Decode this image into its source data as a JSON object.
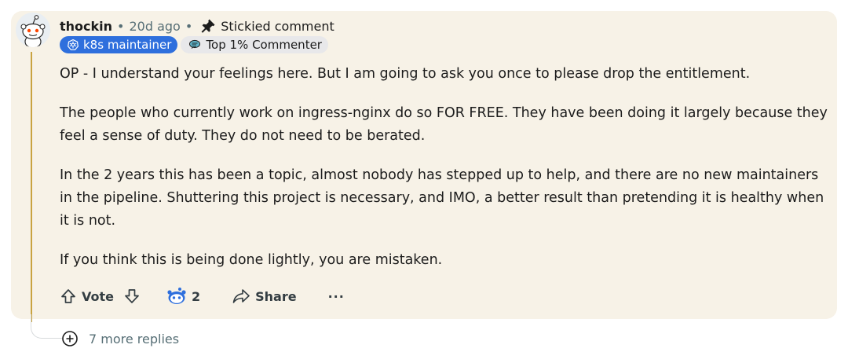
{
  "comment": {
    "username": "thockin",
    "age": "20d ago",
    "sticky_label": "Stickied comment",
    "flairs": [
      {
        "label": "k8s maintainer",
        "icon": "kubernetes-icon"
      },
      {
        "label": "Top 1% Commenter",
        "icon": "top-commenter-icon"
      }
    ],
    "paragraphs": [
      "OP - I understand your feelings here. But I am going to ask you once to please drop the entitlement.",
      "The people who currently work on ingress-nginx do so FOR FREE. They have been doing it largely because they feel a sense of duty. They do not need to be berated.",
      "In the 2 years this has been a topic, almost nobody has stepped up to help, and there are no new maintainers in the pipeline. Shuttering this project is necessary, and IMO, a better result than pretending it is healthy when it is not.",
      "If you think this is being done lightly, you are mistaken."
    ]
  },
  "actions": {
    "vote_label": "Vote",
    "award_count": "2",
    "share_label": "Share",
    "more_label": "···"
  },
  "replies": {
    "more_label": "7 more replies"
  },
  "colors": {
    "card_bg": "#f7f2e7",
    "thread_line": "#c9a341",
    "flair_blue": "#2e6fdd"
  }
}
